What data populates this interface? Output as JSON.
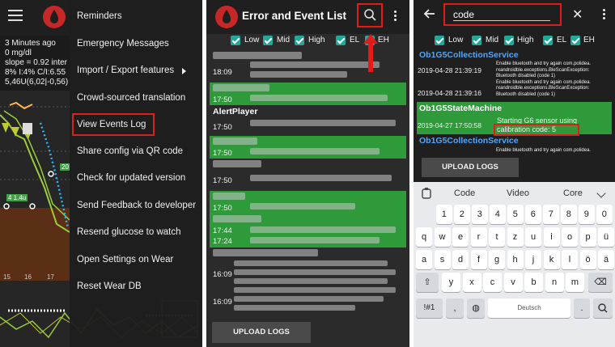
{
  "colors": {
    "accent_red": "#e31b1b",
    "event_green": "#2e9a3a",
    "checkbox_teal": "#26a69a",
    "service_blue": "#4ea7ff",
    "drawer_bg": "#1e1e1e"
  },
  "panel1": {
    "glucose_info": "3 Minutes ago\n0 mg/dl\nslope = 0.92 inter\n8% I:4% C/I:6.55\n5,46U(6,02|-0,56)",
    "chart": {
      "x_ticks": [
        "15",
        "16",
        "17"
      ],
      "badges": [
        "20",
        "4 1.4u"
      ]
    },
    "menu": [
      {
        "label": "Reminders",
        "has_submenu": false
      },
      {
        "label": "Emergency Messages",
        "has_submenu": false
      },
      {
        "label": "Import / Export features",
        "has_submenu": true
      },
      {
        "label": "Crowd-sourced translation",
        "has_submenu": false
      },
      {
        "label": "View Events Log",
        "has_submenu": false,
        "highlighted": true
      },
      {
        "label": "Share config via QR code",
        "has_submenu": false
      },
      {
        "label": "Check for updated version",
        "has_submenu": false
      },
      {
        "label": "Send Feedback to developer",
        "has_submenu": false
      },
      {
        "label": "Resend glucose to watch",
        "has_submenu": false
      },
      {
        "label": "Open Settings on Wear",
        "has_submenu": false
      },
      {
        "label": "Reset Wear DB",
        "has_submenu": false
      }
    ]
  },
  "panel2": {
    "title": "Error and Event List",
    "filters": [
      {
        "label": "Low",
        "checked": true
      },
      {
        "label": "Mid",
        "checked": true
      },
      {
        "label": "High",
        "checked": true
      },
      {
        "label": "EL",
        "checked": true
      },
      {
        "label": "EH",
        "checked": true
      }
    ],
    "rows": [
      {
        "time": "18:09",
        "style": "dark"
      },
      {
        "time": "17:50",
        "style": "green"
      },
      {
        "heading": "AlertPlayer",
        "time": "17:50",
        "style": "dark"
      },
      {
        "time": "17:50",
        "style": "green"
      },
      {
        "time": "17:50",
        "style": "dark"
      },
      {
        "time": "17:50",
        "style": "green"
      },
      {
        "time": "17:44",
        "time2": "17:24",
        "style": "green"
      },
      {
        "time": "16:09",
        "style": "dark"
      },
      {
        "time": "16:09",
        "style": "dark"
      }
    ],
    "upload_label": "UPLOAD LOGS"
  },
  "panel3": {
    "search_value": "code",
    "filters": [
      {
        "label": "Low",
        "checked": true
      },
      {
        "label": "Mid",
        "checked": true
      },
      {
        "label": "High",
        "checked": true
      },
      {
        "label": "EL",
        "checked": true
      },
      {
        "label": "EH",
        "checked": true
      }
    ],
    "entries": [
      {
        "service": "Ob1G5CollectionService",
        "times": [
          "2019-04-28 21:39:19",
          "2019-04-28 21:39:16"
        ],
        "message": "Enable bluetooth and try again com.polidea.\nrxandroidble.exceptions.BleScanException:\nBluetooth disabled (code 1)\nEnable bluetooth and try again com.polidea.\nrxandroidble.exceptions.BleScanException:\nBluetooth disabled (code 1)"
      },
      {
        "service": "Ob1G5StateMachine",
        "times": [
          "2019-04-27 17:50:58"
        ],
        "message": "Starting G6 sensor using\ncalibration code: 5"
      },
      {
        "service": "Ob1G5CollectionService",
        "times": [],
        "message": "Enable bluetooth and try again com.polidea."
      }
    ],
    "upload_label": "UPLOAD LOGS",
    "keyboard": {
      "suggestions": [
        "Code",
        "Video",
        "Core"
      ],
      "row_numbers": [
        "1",
        "2",
        "3",
        "4",
        "5",
        "6",
        "7",
        "8",
        "9",
        "0"
      ],
      "row_q": [
        "q",
        "w",
        "e",
        "r",
        "t",
        "z",
        "u",
        "i",
        "o",
        "p",
        "ü"
      ],
      "row_a": [
        "a",
        "s",
        "d",
        "f",
        "g",
        "h",
        "j",
        "k",
        "l",
        "ö",
        "ä"
      ],
      "row_y": [
        "y",
        "x",
        "c",
        "v",
        "b",
        "n",
        "m"
      ],
      "symbols_key": "!#1",
      "comma_key": ",",
      "space_label": "Deutsch",
      "period_key": "."
    }
  }
}
